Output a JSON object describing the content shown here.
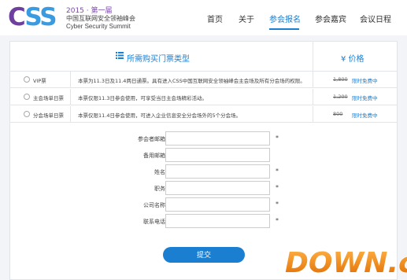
{
  "logo": {
    "mark": "CSS",
    "year": "2015 · 第一届",
    "cn_name": "中国互联网安全领袖峰会",
    "en_name": "Cyber Security Summit"
  },
  "nav": {
    "items": [
      {
        "label": "首页"
      },
      {
        "label": "关于"
      },
      {
        "label": "参会报名"
      },
      {
        "label": "参会嘉宾"
      },
      {
        "label": "会议日程"
      }
    ],
    "active": "参会报名"
  },
  "ticket_table": {
    "header_title": "所需购买门票类型",
    "header_price": "¥ 价格",
    "rows": [
      {
        "name": "VIP票",
        "desc": "本票为11.3日及11.4两日通票。具有进入CSS中国互联网安全领袖峰会主会场及所有分会场的权限。",
        "old_price": "1,800",
        "note": "限时免费中"
      },
      {
        "name": "主会场单日票",
        "desc": "本票仅限11.3日参会使用，可享受当日主会场精彩活动。",
        "old_price": "1,200",
        "note": "限时免费中"
      },
      {
        "name": "分会场单日票",
        "desc": "本票仅限11.4日参会使用，可进入企业信息安全分会场外的5个分会场。",
        "old_price": "800",
        "note": "限时免费中"
      }
    ]
  },
  "form": {
    "fields": [
      {
        "label": "参会者邮箱：",
        "value": "",
        "required": true
      },
      {
        "label": "备用邮箱：",
        "value": "",
        "required": false
      },
      {
        "label": "姓名：",
        "value": "",
        "required": true
      },
      {
        "label": "职务：",
        "value": "",
        "required": true
      },
      {
        "label": "公司名称：",
        "value": "",
        "required": true
      },
      {
        "label": "联系电话：",
        "value": "",
        "required": true
      }
    ],
    "required_mark": "*",
    "submit_label": "提交"
  },
  "watermark": {
    "text": "DOWN.cc"
  },
  "colors": {
    "accent": "#1a7fd1",
    "brand_purple": "#6f3fa0",
    "watermark_orange": "#f08a1c"
  }
}
